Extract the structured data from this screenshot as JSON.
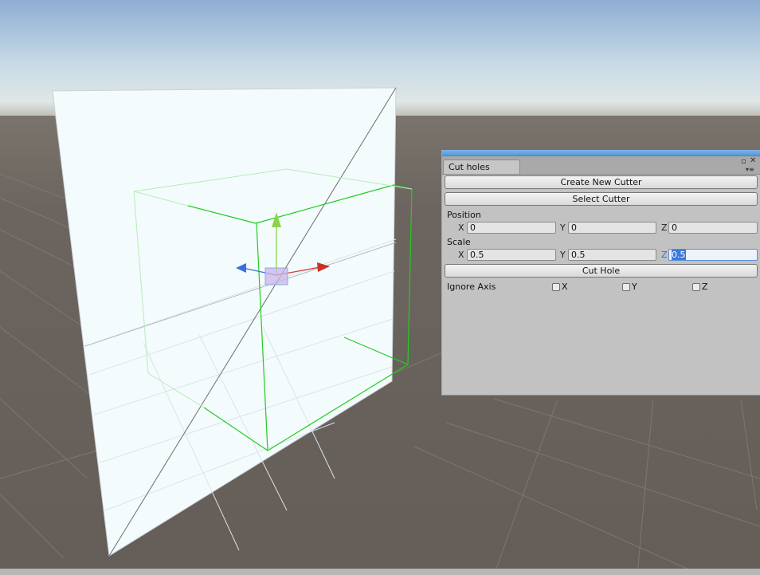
{
  "window": {
    "tab_title": "Cut holes",
    "create_button": "Create New Cutter",
    "select_button": "Select Cutter",
    "position": {
      "label": "Position",
      "x_label": "X",
      "y_label": "Y",
      "z_label": "Z",
      "x": "0",
      "y": "0",
      "z": "0"
    },
    "scale": {
      "label": "Scale",
      "x_label": "X",
      "y_label": "Y",
      "z_label": "Z",
      "x": "0.5",
      "y": "0.5",
      "z": "0.5"
    },
    "cut_button": "Cut Hole",
    "ignore_axis": {
      "label": "Ignore Axis",
      "x_label": "X",
      "y_label": "Y",
      "z_label": "Z",
      "x": false,
      "y": false,
      "z": false
    }
  },
  "scene": {
    "gizmo_colors": {
      "x_axis": "#d8382c",
      "y_axis": "#8fd24a",
      "z_axis": "#3a6fe0"
    },
    "bounds_color": "#22cc22",
    "sky_top": "#8fb0d4",
    "ground": "#6b645f"
  }
}
